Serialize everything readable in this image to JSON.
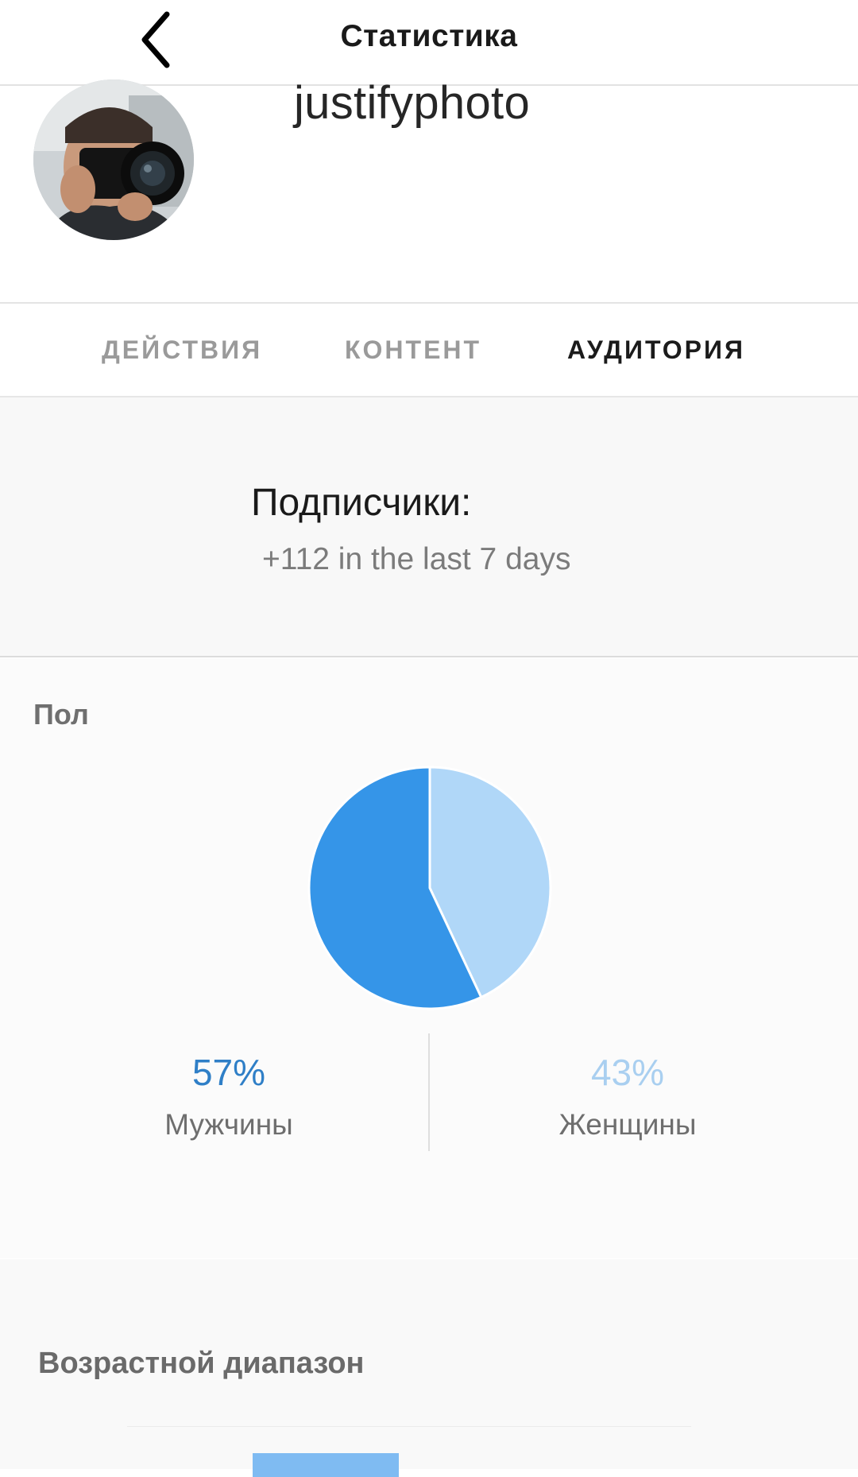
{
  "header": {
    "title": "Статистика",
    "back_icon": "chevron-left-icon"
  },
  "profile": {
    "username": "justifyphoto",
    "avatar_icon": "avatar"
  },
  "tabs": [
    {
      "label": "ДЕЙСТВИЯ",
      "active": false
    },
    {
      "label": "КОНТЕНТ",
      "active": false
    },
    {
      "label": "АУДИТОРИЯ",
      "active": true
    }
  ],
  "followers": {
    "label": "Подписчики:",
    "change": "+112 in the last 7 days"
  },
  "gender": {
    "title": "Пол",
    "male": {
      "percent": "57%",
      "label": "Мужчины"
    },
    "female": {
      "percent": "43%",
      "label": "Женщины"
    }
  },
  "age": {
    "title": "Возрастной диапазон"
  },
  "chart_data": {
    "type": "pie",
    "categories": [
      "Мужчины",
      "Женщины"
    ],
    "values": [
      57,
      43
    ],
    "colors": [
      "#3595e8",
      "#b0d7f8"
    ]
  },
  "colors": {
    "male": "#3595e8",
    "female": "#b0d7f8",
    "active_tab": "#1b1b1b",
    "inactive_tab": "#9a9a9a"
  }
}
